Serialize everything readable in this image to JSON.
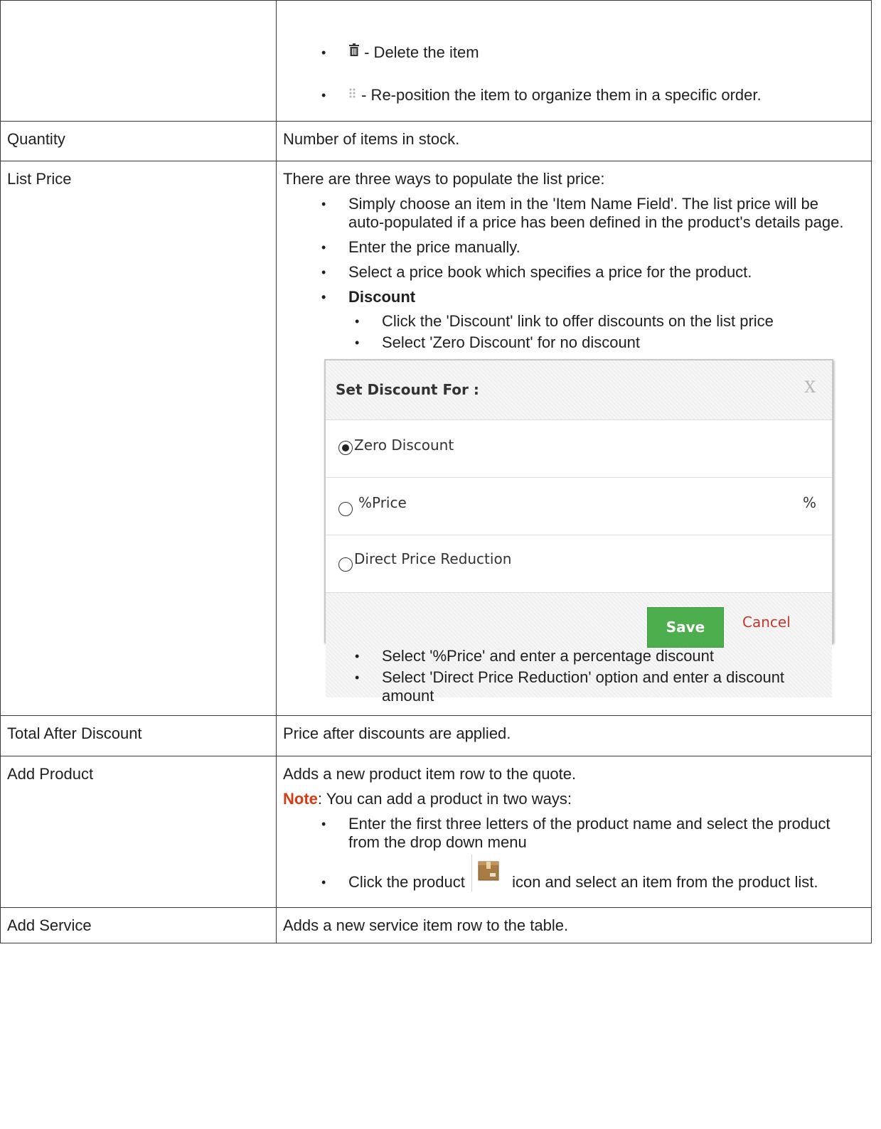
{
  "rows": [
    {
      "label": "",
      "bullets": [
        {
          "icon": "trash-icon",
          "text": " - Delete the item"
        },
        {
          "icon": "drag-handle-icon",
          "text": " - Re-position the item to organize them in a specific order."
        }
      ]
    },
    {
      "label": "Quantity",
      "text": "Number of items in stock."
    },
    {
      "label": "List Price",
      "intro": "There are three ways to populate the list price:",
      "bullets": [
        "Simply choose an item in the 'Item Name Field'. The list price will be auto-populated if a price has been defined in the product's details page.",
        "Enter the price manually.",
        "Select a price book which specifies a price for the product.",
        "Discount"
      ],
      "sub_bullets_before": [
        "Click the 'Discount' link to offer discounts on the list price",
        "Select 'Zero Discount' for no discount"
      ],
      "sub_bullets_after": [
        "Select '%Price' and enter a percentage discount",
        "Select 'Direct Price Reduction' option and enter a discount amount"
      ]
    },
    {
      "label": "Total After Discount",
      "text": "Price after discounts are applied."
    },
    {
      "label": "Add Product",
      "text": "Adds a new product item row to the quote.",
      "note_label": "Note",
      "note_text": ": You can add a product in two ways:",
      "bullets": [
        "Enter the first three letters of the product name and select the product from the drop down menu"
      ],
      "icon_bullet": {
        "before": "Click the product ",
        "icon": "product-box-icon",
        "after": " icon and select an item from the product list."
      }
    },
    {
      "label": "Add Service",
      "text": "Adds a new service item row to the table."
    }
  ],
  "dialog": {
    "title": "Set Discount For :",
    "close": "X",
    "options": [
      {
        "label": "Zero Discount",
        "selected": true
      },
      {
        "label": "%Price",
        "selected": false,
        "suffix": "%"
      },
      {
        "label": "Direct Price Reduction",
        "selected": false
      }
    ],
    "save_label": "Save",
    "cancel_label": "Cancel"
  }
}
